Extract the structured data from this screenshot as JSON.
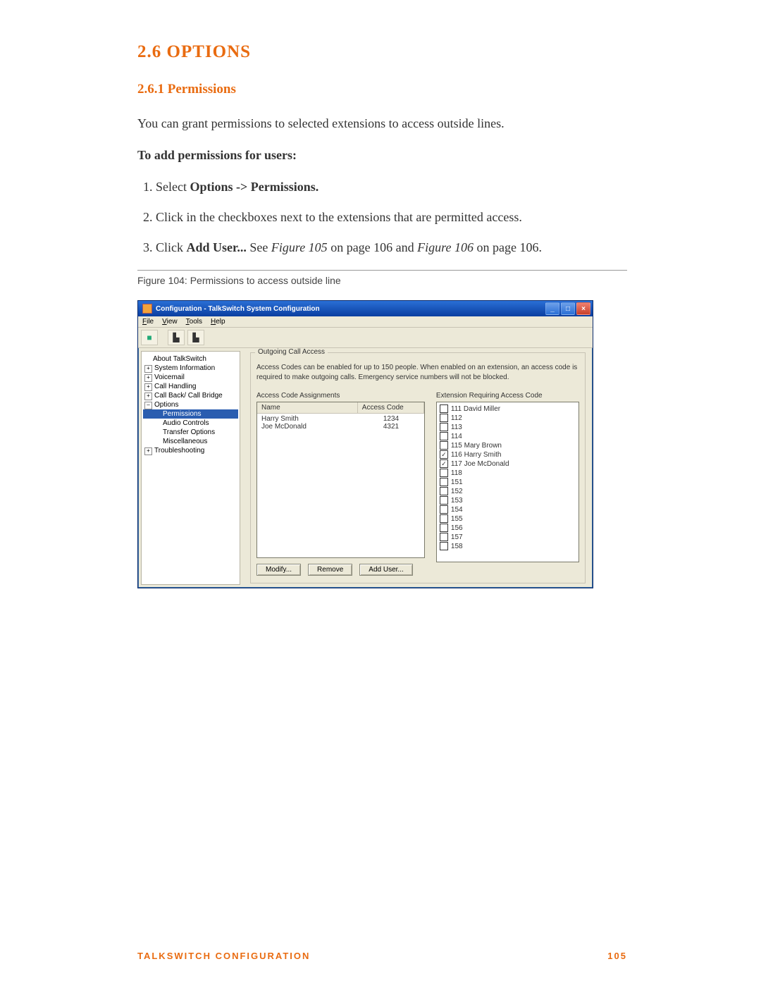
{
  "section_number": "2.6",
  "section_title": "OPTIONS",
  "subsection_number": "2.6.1",
  "subsection_title": "Permissions",
  "intro": "You can grant permissions to selected extensions to access outside lines.",
  "procedure_heading": "To add permissions for users:",
  "steps": {
    "s1_pre": "Select ",
    "s1_bold": "Options -> Permissions.",
    "s2": "Click in the checkboxes next to the extensions that are permitted access.",
    "s3_pre": "Click ",
    "s3_bold": "Add User...",
    "s3_mid1": " See ",
    "s3_fig1": "Figure 105",
    "s3_mid2": " on page 106 and ",
    "s3_fig2": "Figure 106",
    "s3_end": " on page 106."
  },
  "figure_caption": "Figure 104:  Permissions to access outside line",
  "window": {
    "title": "Configuration - TalkSwitch System Configuration",
    "controls": {
      "min": "_",
      "max": "□",
      "close": "×"
    },
    "menu": {
      "file": "File",
      "view": "View",
      "tools": "Tools",
      "help": "Help"
    },
    "tree": {
      "about": "About TalkSwitch",
      "sysinfo": "System Information",
      "voicemail": "Voicemail",
      "callhandling": "Call Handling",
      "callback": "Call Back/ Call Bridge",
      "options": "Options",
      "permissions": "Permissions",
      "audio": "Audio Controls",
      "transfer": "Transfer Options",
      "misc": "Miscellaneous",
      "trouble": "Troubleshooting"
    },
    "panel": {
      "group_legend": "Outgoing Call Access",
      "desc": "Access Codes can be enabled for up to 150 people. When enabled on an extension, an access code is required to make outgoing calls. Emergency service numbers will not be blocked.",
      "assign_label": "Access Code Assignments",
      "ext_label": "Extension Requiring Access Code",
      "headers": {
        "name": "Name",
        "code": "Access Code"
      },
      "rows": [
        {
          "name": "Harry Smith",
          "code": "1234"
        },
        {
          "name": "Joe McDonald",
          "code": "4321"
        }
      ],
      "extensions": [
        {
          "label": "111 David Miller",
          "checked": false
        },
        {
          "label": "112",
          "checked": false
        },
        {
          "label": "113",
          "checked": false
        },
        {
          "label": "114",
          "checked": false
        },
        {
          "label": "115 Mary Brown",
          "checked": false
        },
        {
          "label": "116 Harry Smith",
          "checked": true
        },
        {
          "label": "117 Joe McDonald",
          "checked": true
        },
        {
          "label": "118",
          "checked": false
        },
        {
          "label": "151",
          "checked": false
        },
        {
          "label": "152",
          "checked": false
        },
        {
          "label": "153",
          "checked": false
        },
        {
          "label": "154",
          "checked": false
        },
        {
          "label": "155",
          "checked": false
        },
        {
          "label": "156",
          "checked": false
        },
        {
          "label": "157",
          "checked": false
        },
        {
          "label": "158",
          "checked": false
        }
      ],
      "buttons": {
        "modify": "Modify...",
        "remove": "Remove",
        "adduser": "Add User..."
      }
    }
  },
  "footer": {
    "left": "TALKSWITCH CONFIGURATION",
    "right": "105"
  }
}
